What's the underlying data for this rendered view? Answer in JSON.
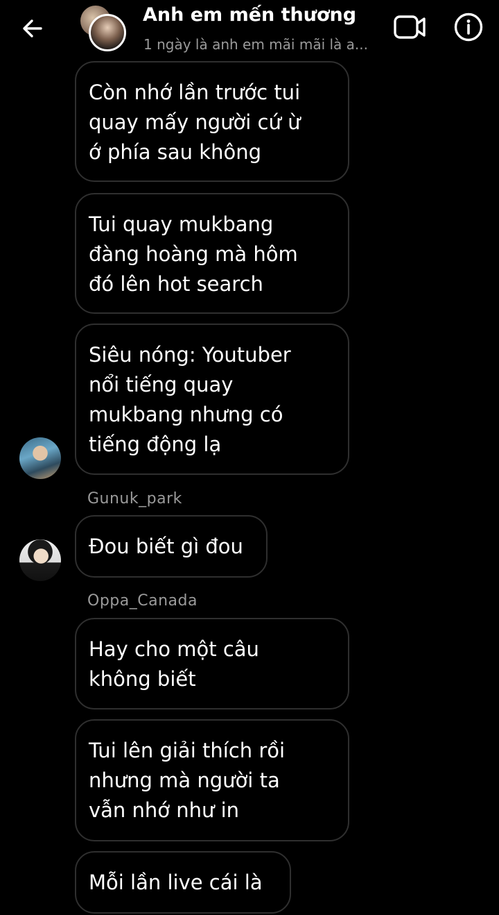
{
  "header": {
    "title": "Anh em mến thương",
    "subtitle": "1 ngày là anh em mãi mãi là a..."
  },
  "messages": [
    {
      "text": "Còn nhớ lần trước tui\nquay mấy người cứ ừ\nớ phía sau không"
    },
    {
      "text": "Tui quay mukbang\nđàng hoàng mà hôm\nđó lên hot search"
    },
    {
      "text": "Siêu nóng: Youtuber\nnổi tiếng quay\nmukbang nhưng có\ntiếng động lạ"
    },
    {
      "text": "Đou biết gì đou"
    },
    {
      "text": "Hay cho một câu\nkhông biết"
    },
    {
      "text": "Tui lên giải thích rồi\nnhưng mà người ta\nvẫn nhớ như in"
    },
    {
      "text": "Mỗi lần live cái là"
    }
  ],
  "senders": [
    "Gunuk_park",
    "Oppa_Canada"
  ],
  "icons": {
    "back": "arrow-left-icon",
    "video": "video-camera-icon",
    "info": "info-icon"
  },
  "colors": {
    "background": "#000000",
    "bubble_border": "#2f2f2f",
    "secondary_text": "#9a9a9a"
  }
}
